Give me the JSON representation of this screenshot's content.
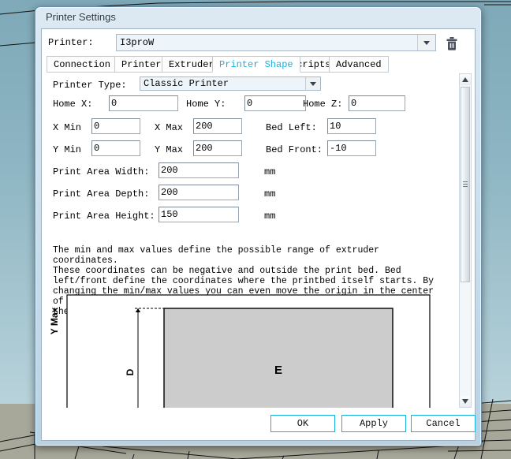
{
  "window": {
    "title": "Printer Settings"
  },
  "printer_row": {
    "label": "Printer:",
    "value": "I3proW",
    "delete_icon": "trash-icon",
    "dropdown_icon": "chevron-down-icon"
  },
  "tabs": [
    {
      "label": "Connection",
      "active": false
    },
    {
      "label": "Printer",
      "active": false
    },
    {
      "label": "Extruder",
      "active": false
    },
    {
      "label": "Printer Shape",
      "active": true
    },
    {
      "label": "Scripts",
      "active": false
    },
    {
      "label": "Advanced",
      "active": false
    }
  ],
  "form": {
    "printer_type_label": "Printer Type:",
    "printer_type_value": "Classic Printer",
    "home_x_label": "Home X:",
    "home_x_value": "0",
    "home_y_label": "Home Y:",
    "home_y_value": "0",
    "home_z_label": "Home Z:",
    "home_z_value": "0",
    "x_min_label": "X Min",
    "x_min_value": "0",
    "x_max_label": "X Max",
    "x_max_value": "200",
    "bed_left_label": "Bed Left:",
    "bed_left_value": "10",
    "y_min_label": "Y Min",
    "y_min_value": "0",
    "y_max_label": "Y Max",
    "y_max_value": "200",
    "bed_front_label": "Bed Front:",
    "bed_front_value": "-10",
    "print_area_width_label": "Print Area Width:",
    "print_area_width_value": "200",
    "print_area_width_unit": "mm",
    "print_area_depth_label": "Print Area Depth:",
    "print_area_depth_value": "200",
    "print_area_depth_unit": "mm",
    "print_area_height_label": "Print Area Height:",
    "print_area_height_value": "150",
    "print_area_height_unit": "mm",
    "description": "The min and max values define the possible range of extruder coordinates.\nThese coordinates can be negative and outside the print bed. Bed\nleft/front define the coordinates where the printbed itself starts. By\nchanging the min/max values you can even move the origin in the center of\nthe print bed, if supported by firmware."
  },
  "diagram": {
    "y_max_label": "Y Max",
    "dimension_label": "D",
    "bed_label": "E"
  },
  "footer": {
    "ok_label": "OK",
    "apply_label": "Apply",
    "cancel_label": "Cancel"
  },
  "colors": {
    "accent": "#15b2de",
    "bed_fill": "#cccccc",
    "field_bg": "#edf5fa"
  }
}
